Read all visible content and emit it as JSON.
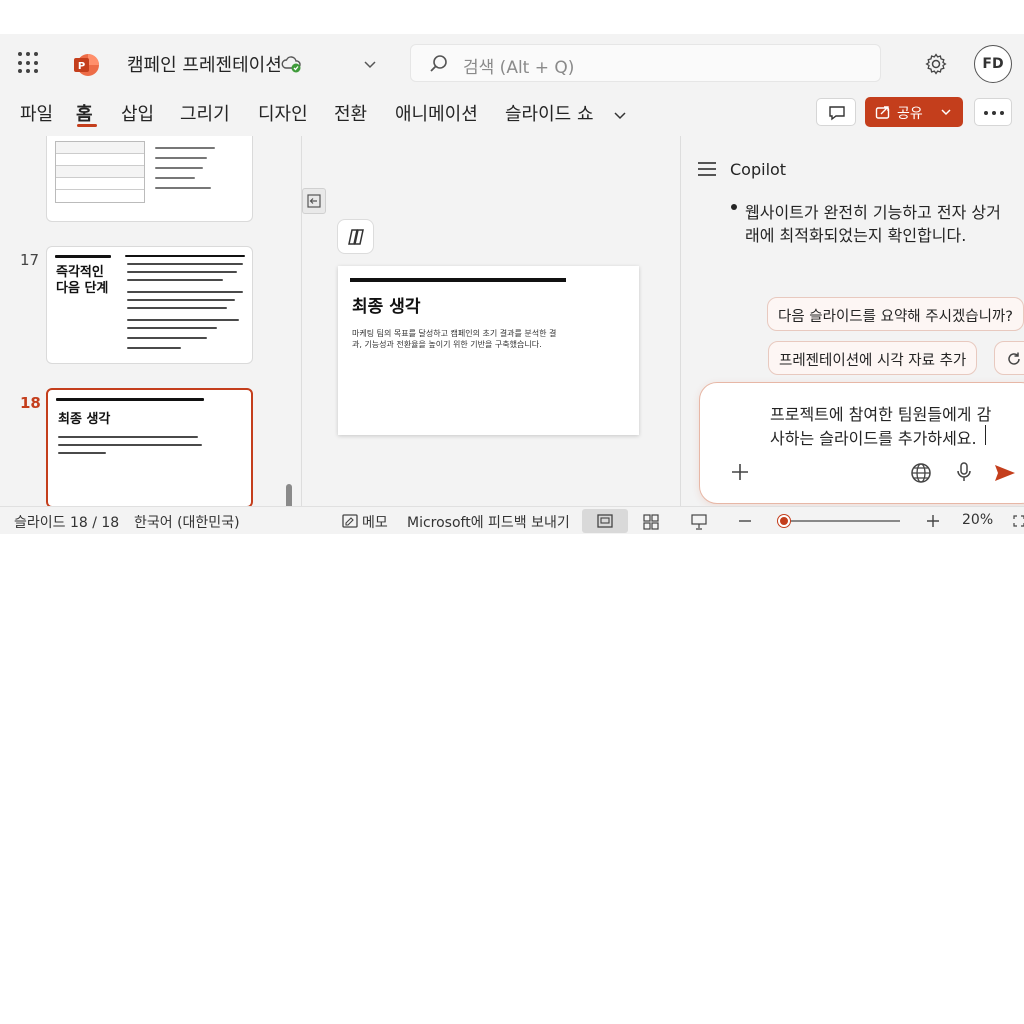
{
  "app": {
    "name": "PowerPoint",
    "doc_title": "캠페인 프레젠테이션",
    "search_placeholder": "검색 (Alt + Q)",
    "user_initials": "FD",
    "accent_color": "#c43e1c"
  },
  "ribbon": {
    "tabs": [
      "파일",
      "홈",
      "삽입",
      "그리기",
      "디자인",
      "전환",
      "애니메이션",
      "슬라이드 쇼"
    ],
    "active_tab": "홈",
    "share_label": "공유"
  },
  "thumbnails": [
    {
      "number": "17",
      "title_line1": "즉각적인",
      "title_line2": "다음 단계"
    },
    {
      "number": "18",
      "title": "최종 생각",
      "selected": true
    }
  ],
  "slide": {
    "title": "최종 생각",
    "body": "마케팅 팀의 목표를 달성하고 캠페인의 초기 결과를 분석한 결과, 기능성과 전환율을 높이기 위한 기반을 구축했습니다."
  },
  "copilot": {
    "title": "Copilot",
    "response_line1": "웹사이트가 완전히 기능하고 전자 상거",
    "response_line2": "래에 최적화되었는지 확인합니다.",
    "suggestions": [
      "다음 슬라이드를 요약해 주시겠습니까?",
      "프레젠테이션에 시각 자료 추가"
    ],
    "input_line1": "프로젝트에 참여한 팀원들에게 감",
    "input_line2": "사하는 슬라이드를 추가하세요."
  },
  "statusbar": {
    "slide_counter": "슬라이드 18 / 18",
    "language": "한국어 (대한민국)",
    "notes": "메모",
    "feedback": "Microsoft에 피드백 보내기",
    "zoom": "20%",
    "zoom_fraction": 0.0
  }
}
